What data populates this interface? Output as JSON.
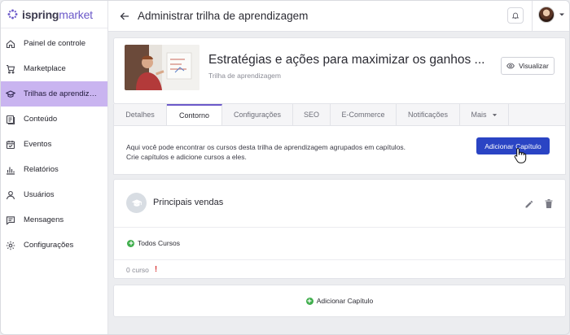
{
  "brand": {
    "name_part1": "ispring",
    "name_part2": "market",
    "accent": "#6b59c9"
  },
  "sidebar": {
    "items": [
      {
        "label": "Painel de controle",
        "icon": "home-icon"
      },
      {
        "label": "Marketplace",
        "icon": "cart-icon"
      },
      {
        "label": "Trilhas de aprendizag...",
        "icon": "graduation-cap-icon",
        "active": true
      },
      {
        "label": "Conteúdo",
        "icon": "content-icon"
      },
      {
        "label": "Eventos",
        "icon": "calendar-icon"
      },
      {
        "label": "Relatórios",
        "icon": "bar-chart-icon"
      },
      {
        "label": "Usuários",
        "icon": "user-icon"
      },
      {
        "label": "Mensagens",
        "icon": "message-icon"
      },
      {
        "label": "Configurações",
        "icon": "gear-icon"
      }
    ]
  },
  "header": {
    "title": "Administrar trilha de aprendizagem"
  },
  "course": {
    "title": "Estratégias e ações para maximizar os ganhos ...",
    "subtitle": "Trilha de aprendizagem",
    "view_label": "Visualizar"
  },
  "tabs": [
    {
      "label": "Detalhes"
    },
    {
      "label": "Contorno",
      "active": true
    },
    {
      "label": "Configurações"
    },
    {
      "label": "SEO"
    },
    {
      "label": "E-Commerce"
    },
    {
      "label": "Notificações"
    },
    {
      "label": "Mais"
    }
  ],
  "info": {
    "line1": "Aqui você pode encontrar os cursos desta trilha de aprendizagem agrupados em capítulos.",
    "line2": "Crie capítulos e adicione cursos a eles.",
    "add_chapter_label": "Adicionar Capítulo"
  },
  "chapter": {
    "title": "Principais vendas",
    "all_courses_label": "Todos Cursos",
    "course_count": "0 curso",
    "warning": "!"
  },
  "footer_add": {
    "label": "Adicionar Capítulo"
  },
  "colors": {
    "primary": "#2a44c4",
    "active_nav": "#c9b4f0",
    "success": "#3fae4c",
    "warning": "#d93a3a"
  }
}
